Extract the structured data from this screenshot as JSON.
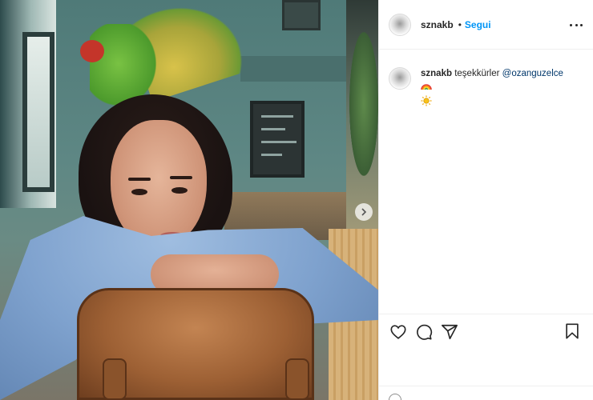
{
  "post": {
    "username": "sznakb",
    "separator": "•",
    "follow_label": "Segui",
    "caption": {
      "username": "sznakb",
      "text": "teşekkürler",
      "mention": "@ozanguzelce",
      "emojis": [
        "rainbow",
        "sun"
      ]
    }
  },
  "icons": {
    "more": "more-options-icon",
    "like": "heart-icon",
    "comment": "comment-icon",
    "share": "share-icon",
    "save": "bookmark-icon",
    "next": "chevron-right-icon"
  },
  "colors": {
    "accent": "#0095f6",
    "mention": "#00376b",
    "text": "#262626",
    "divider": "#efefef"
  }
}
